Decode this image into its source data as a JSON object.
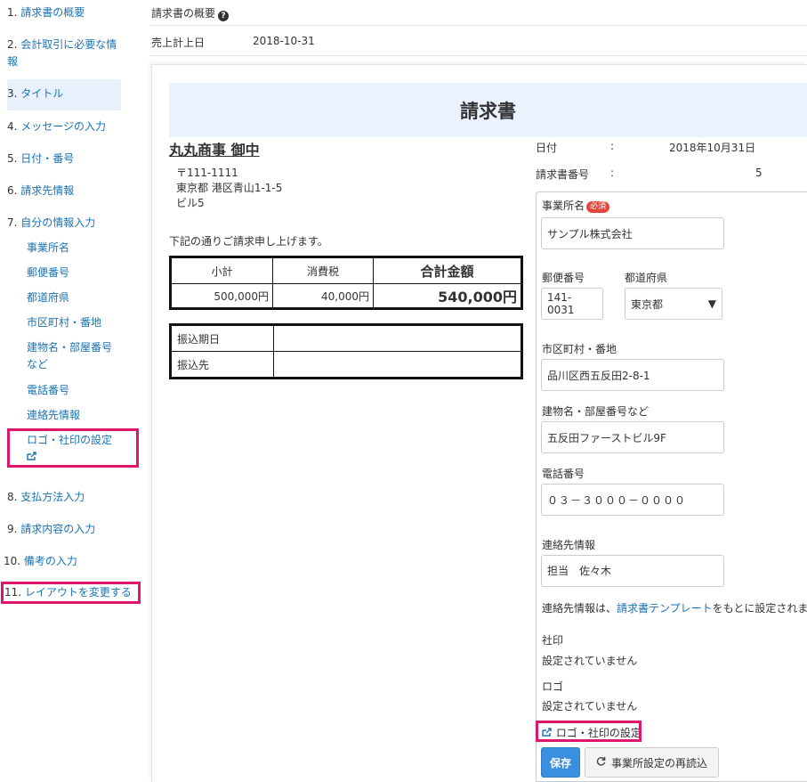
{
  "sidebar": {
    "items": [
      {
        "num": "1.",
        "label": "請求書の概要"
      },
      {
        "num": "2.",
        "label": "会計取引に必要な情報"
      },
      {
        "num": "3.",
        "label": "タイトル"
      },
      {
        "num": "4.",
        "label": "メッセージの入力"
      },
      {
        "num": "5.",
        "label": "日付・番号"
      },
      {
        "num": "6.",
        "label": "請求先情報"
      },
      {
        "num": "7.",
        "label": "自分の情報入力"
      },
      {
        "num": "8.",
        "label": "支払方法入力"
      },
      {
        "num": "9.",
        "label": "請求内容の入力"
      },
      {
        "num": "10.",
        "label": "備考の入力"
      },
      {
        "num": "11.",
        "label": "レイアウトを変更する"
      }
    ],
    "subitems": [
      "事業所名",
      "郵便番号",
      "都道府県",
      "市区町村・番地",
      "建物名・部屋番号など",
      "電話番号",
      "連絡先情報",
      "ロゴ・社印の設定"
    ]
  },
  "header": {
    "overview_label": "請求書の概要",
    "sales_date_label": "売上計上日",
    "sales_date_value": "2018-10-31"
  },
  "invoice": {
    "title": "請求書",
    "client_name": "丸丸商事 御中",
    "postal": "〒111-1111",
    "address1": "東京都 港区青山1-1-5",
    "address2": "ビル5",
    "date_label": "日付",
    "date_value": "2018年10月31日",
    "number_label": "請求書番号",
    "number_value": "5",
    "colon": ":",
    "message": "下記の通りご請求申し上げます。",
    "subtotal_label": "小計",
    "tax_label": "消費税",
    "total_label": "合計金額",
    "subtotal_value": "500,000円",
    "tax_value": "40,000円",
    "total_value": "540,000円",
    "due_label": "振込期日",
    "bank_label": "振込先"
  },
  "form": {
    "company_label": "事業所名",
    "required_badge": "必須",
    "company_value": "サンプル株式会社",
    "postal_label": "郵便番号",
    "postal_value": "141-0031",
    "pref_label": "都道府県",
    "pref_value": "東京都",
    "city_label": "市区町村・番地",
    "city_value": "品川区西五反田2-8-1",
    "building_label": "建物名・部屋番号など",
    "building_value": "五反田ファーストビル9F",
    "phone_label": "電話番号",
    "phone_value": "０３－３０００－００００",
    "contact_label": "連絡先情報",
    "contact_value": "担当　佐々木",
    "note_prefix": "連絡先情報は、",
    "note_link": "請求書テンプレート",
    "note_suffix": "をもとに設定されます",
    "seal_label": "社印",
    "seal_value": "設定されていません",
    "logo_label": "ロゴ",
    "logo_value": "設定されていません",
    "logo_seal_link": "ロゴ・社印の設定",
    "save_button": "保存",
    "reload_button": "事業所設定の再読込"
  },
  "colors": {
    "link": "#1a73b5",
    "highlight": "#e0166e",
    "primary": "#3a8fe0",
    "title_band": "#e9f2fd"
  }
}
